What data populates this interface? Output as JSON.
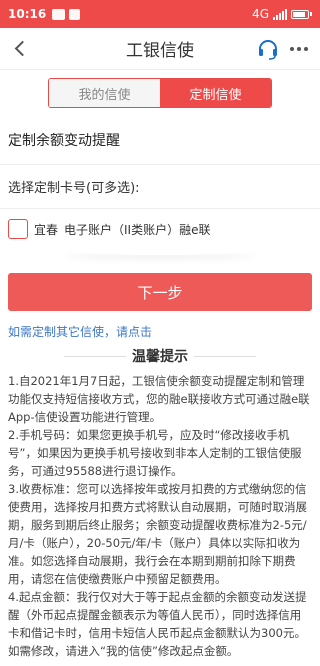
{
  "status": {
    "time": "10:16",
    "network": "4G"
  },
  "header": {
    "title": "工银信使"
  },
  "tabs": [
    {
      "label": "我的信使"
    },
    {
      "label": "定制信使"
    }
  ],
  "form": {
    "section_title": "定制余额变动提醒",
    "select_label": "选择定制卡号(可多选):",
    "card": {
      "branch": "宜春",
      "desc": "电子账户（II类账户）融e联"
    },
    "next_button": "下一步",
    "other_link": "如需定制其它信使，请点击"
  },
  "tips": {
    "title": "温馨提示",
    "items": [
      "1.自2021年1月7日起，工银信使余额变动提醒定制和管理功能仅支持短信接收方式，您的融e联接收方式可通过融e联App-信使设置功能进行管理。",
      "2.手机号码：如果您更换手机号，应及时“修改接收手机号”，如果因为更换手机号接收到非本人定制的工银信使服务，可通过95588进行退订操作。",
      "3.收费标准：您可以选择按年或按月扣费的方式缴纳您的信使费用，选择按月扣费方式将默认自动展期，可随时取消展期，服务到期后终止服务；余额变动提醒收费标准为2-5元/月/卡（账户），20-50元/年/卡（账户）具体以实际扣收为准。如您选择自动展期，我行会在本期到期前扣除下期费用，请您在信使缴费账户中预留足额费用。",
      "4.起点金额：我行仅对大于等于起点金额的余额变动发送提醒（外币起点提醒金额表示为等值人民币），同时选择信用卡和借记卡时，信用卡短信人民币起点金额默认为300元。如需修改，请进入“我的信使”修改起点金额。"
    ]
  }
}
